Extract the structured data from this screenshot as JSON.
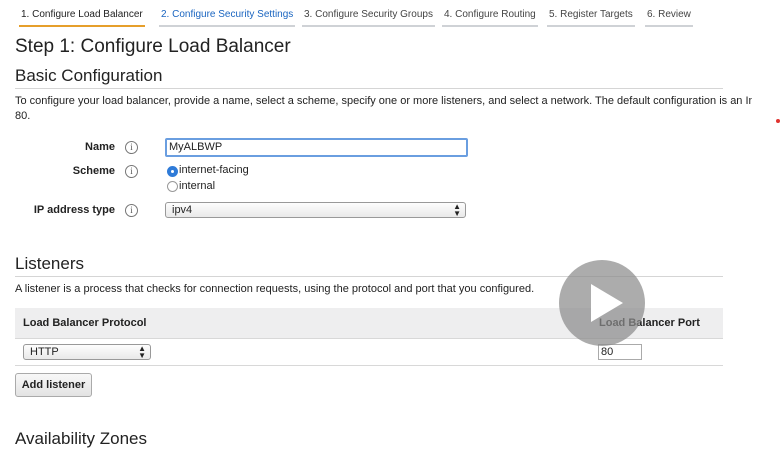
{
  "tabs": [
    {
      "label": "1. Configure Load Balancer"
    },
    {
      "label": "2. Configure Security Settings"
    },
    {
      "label": "3. Configure Security Groups"
    },
    {
      "label": "4. Configure Routing"
    },
    {
      "label": "5. Register Targets"
    },
    {
      "label": "6. Review"
    }
  ],
  "page": {
    "title": "Step 1: Configure Load Balancer"
  },
  "basic": {
    "heading": "Basic Configuration",
    "description_line1": "To configure your load balancer, provide a name, select a scheme, specify one or more listeners, and select a network. The default configuration is an In",
    "description_line2": "80.",
    "name_label": "Name",
    "name_value": "MyALBWP",
    "scheme_label": "Scheme",
    "scheme_options": [
      "internet-facing",
      "internal"
    ],
    "scheme_selected": "internet-facing",
    "ip_label": "IP address type",
    "ip_value": "ipv4",
    "info_glyph": "i"
  },
  "listeners": {
    "heading": "Listeners",
    "description": "A listener is a process that checks for connection requests, using the protocol and port that you configured.",
    "col_protocol": "Load Balancer Protocol",
    "col_port": "Load Balancer Port",
    "protocol_value": "HTTP",
    "port_value": "80",
    "add_button": "Add listener"
  },
  "availability": {
    "heading": "Availability Zones"
  },
  "colors": {
    "accent_tab": "#e69f2b",
    "link": "#1a65c0",
    "radio_selected": "#2f7bd8"
  },
  "icons": {
    "info": "info-icon",
    "play": "play-icon",
    "select_arrows": "select-arrows-icon"
  }
}
